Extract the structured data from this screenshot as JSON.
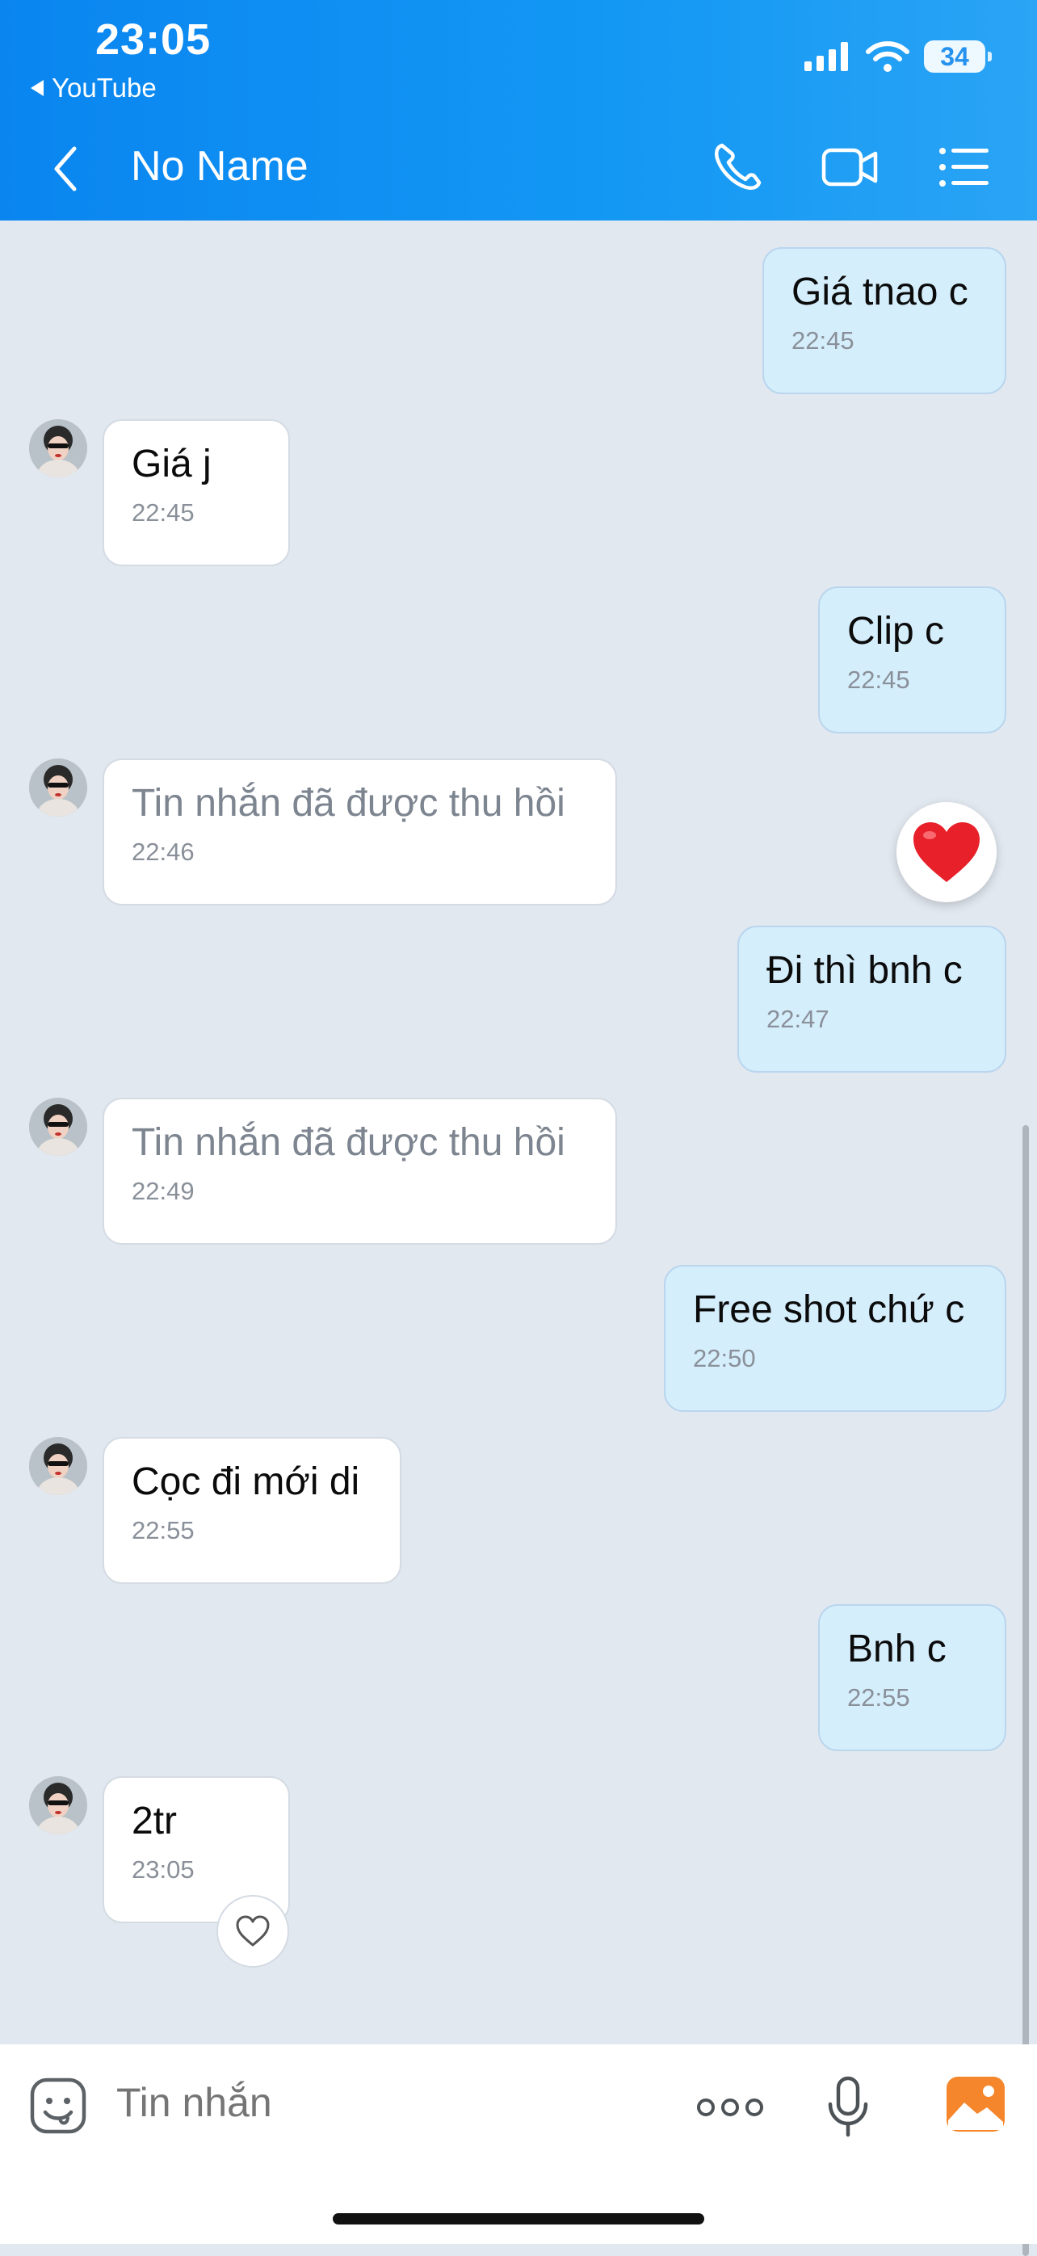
{
  "status_bar": {
    "time": "23:05",
    "back_app": "YouTube",
    "battery": "34"
  },
  "nav": {
    "title": "No Name"
  },
  "messages": [
    {
      "dir": "out",
      "text": "Giá tnao c",
      "time": "22:45"
    },
    {
      "dir": "in",
      "text": "Giá j",
      "time": "22:45"
    },
    {
      "dir": "out",
      "text": "Clip c",
      "time": "22:45"
    },
    {
      "dir": "in",
      "text": "Tin nhắn đã được thu hồi",
      "time": "22:46",
      "recalled": true
    },
    {
      "dir": "out",
      "text": "Đi thì bnh c",
      "time": "22:47"
    },
    {
      "dir": "in",
      "text": "Tin nhắn đã được thu hồi",
      "time": "22:49",
      "recalled": true
    },
    {
      "dir": "out",
      "text": "Free shot chứ c",
      "time": "22:50"
    },
    {
      "dir": "in",
      "text": "Cọc đi mới di",
      "time": "22:55"
    },
    {
      "dir": "out",
      "text": "Bnh c",
      "time": "22:55"
    },
    {
      "dir": "in",
      "text": "2tr",
      "time": "23:05"
    }
  ],
  "input": {
    "placeholder": "Tin nhắn"
  },
  "colors": {
    "header": "#0a85f0",
    "bubble_out": "#d5eefc",
    "bubble_in": "#ffffff",
    "heart": "#e8202a",
    "gallery": "#f5862b"
  }
}
